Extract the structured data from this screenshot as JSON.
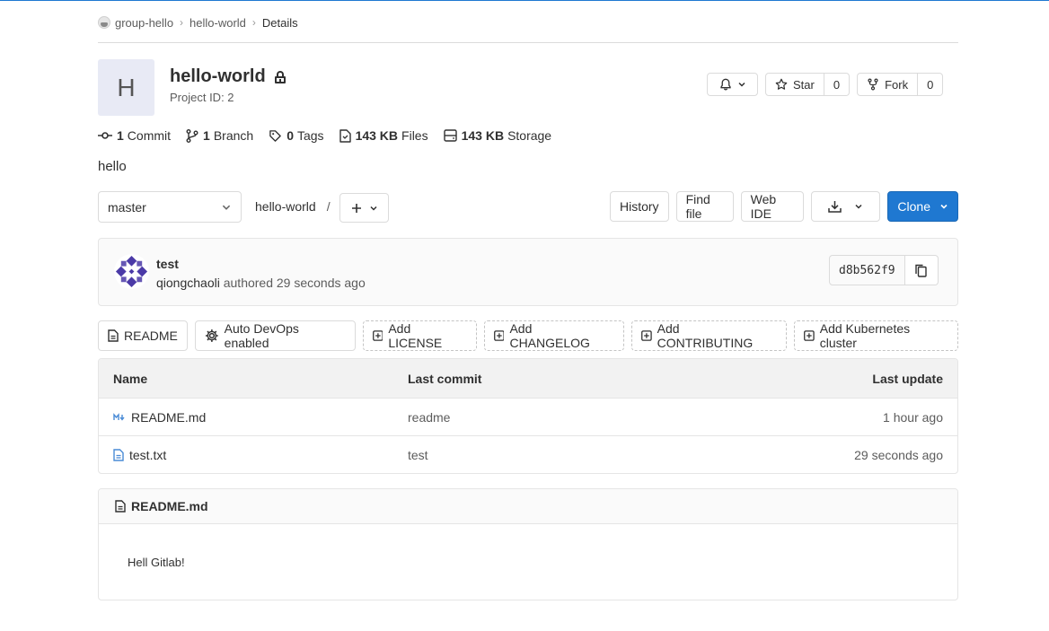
{
  "breadcrumb": {
    "group": "group-hello",
    "project": "hello-world",
    "current": "Details"
  },
  "project": {
    "avatar_letter": "H",
    "name": "hello-world",
    "id_label": "Project ID: 2",
    "description": "hello",
    "star_label": "Star",
    "star_count": "0",
    "fork_label": "Fork",
    "fork_count": "0"
  },
  "stats": {
    "commits_count": "1",
    "commits_label": "Commit",
    "branches_count": "1",
    "branches_label": "Branch",
    "tags_count": "0",
    "tags_label": "Tags",
    "files_size": "143 KB",
    "files_label": "Files",
    "storage_size": "143 KB",
    "storage_label": "Storage"
  },
  "tree": {
    "ref": "master",
    "path_root": "hello-world",
    "path_sep": "/",
    "history": "History",
    "find_file": "Find file",
    "web_ide": "Web IDE",
    "clone": "Clone"
  },
  "last_commit": {
    "title": "test",
    "author": "qiongchaoli",
    "meta": "authored 29 seconds ago",
    "sha": "d8b562f9"
  },
  "quick_buttons": [
    "README",
    "Auto DevOps enabled",
    "Add LICENSE",
    "Add CHANGELOG",
    "Add CONTRIBUTING",
    "Add Kubernetes cluster"
  ],
  "file_table": {
    "headers": {
      "name": "Name",
      "last_commit": "Last commit",
      "last_update": "Last update"
    },
    "rows": [
      {
        "name": "README.md",
        "commit": "readme",
        "updated": "1 hour ago"
      },
      {
        "name": "test.txt",
        "commit": "test",
        "updated": "29 seconds ago"
      }
    ]
  },
  "readme": {
    "filename": "README.md",
    "content": "Hell Gitlab!"
  },
  "colors": {
    "primary": "#1f78d1",
    "border": "#dbdbdb",
    "text": "#303030",
    "muted": "#5c5c5c"
  }
}
